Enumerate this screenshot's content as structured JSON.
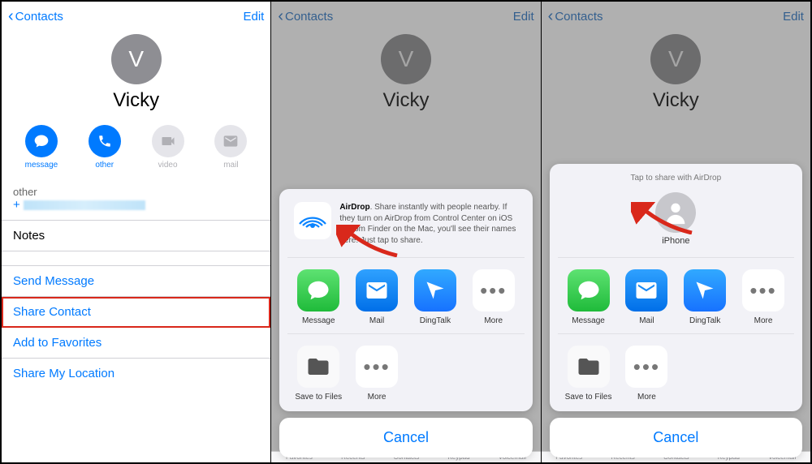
{
  "nav": {
    "back": "Contacts",
    "edit": "Edit"
  },
  "contact": {
    "initial": "V",
    "name": "Vicky"
  },
  "actions": {
    "message": "message",
    "other": "other",
    "video": "video",
    "mail": "mail"
  },
  "details": {
    "phone_label": "other",
    "phone_prefix": "+",
    "notes": "Notes"
  },
  "links": {
    "send_message": "Send Message",
    "share_contact": "Share Contact",
    "add_favorites": "Add to Favorites",
    "share_location": "Share My Location"
  },
  "share_sheet": {
    "airdrop_bold": "AirDrop",
    "airdrop_desc": ". Share instantly with people nearby. If they turn on AirDrop from Control Center on iOS or from Finder on the Mac, you'll see their names here. Just tap to share.",
    "tap_title": "Tap to share with AirDrop",
    "target_label": "iPhone",
    "apps": {
      "message": "Message",
      "mail": "Mail",
      "dingtalk": "DingTalk",
      "more": "More"
    },
    "actions": {
      "save_files": "Save to Files",
      "more": "More"
    },
    "cancel": "Cancel"
  },
  "tabs": {
    "favorites": "Favorites",
    "recents": "Recents",
    "contacts": "Contacts",
    "keypad": "Keypad",
    "voicemail": "Voicemail"
  }
}
